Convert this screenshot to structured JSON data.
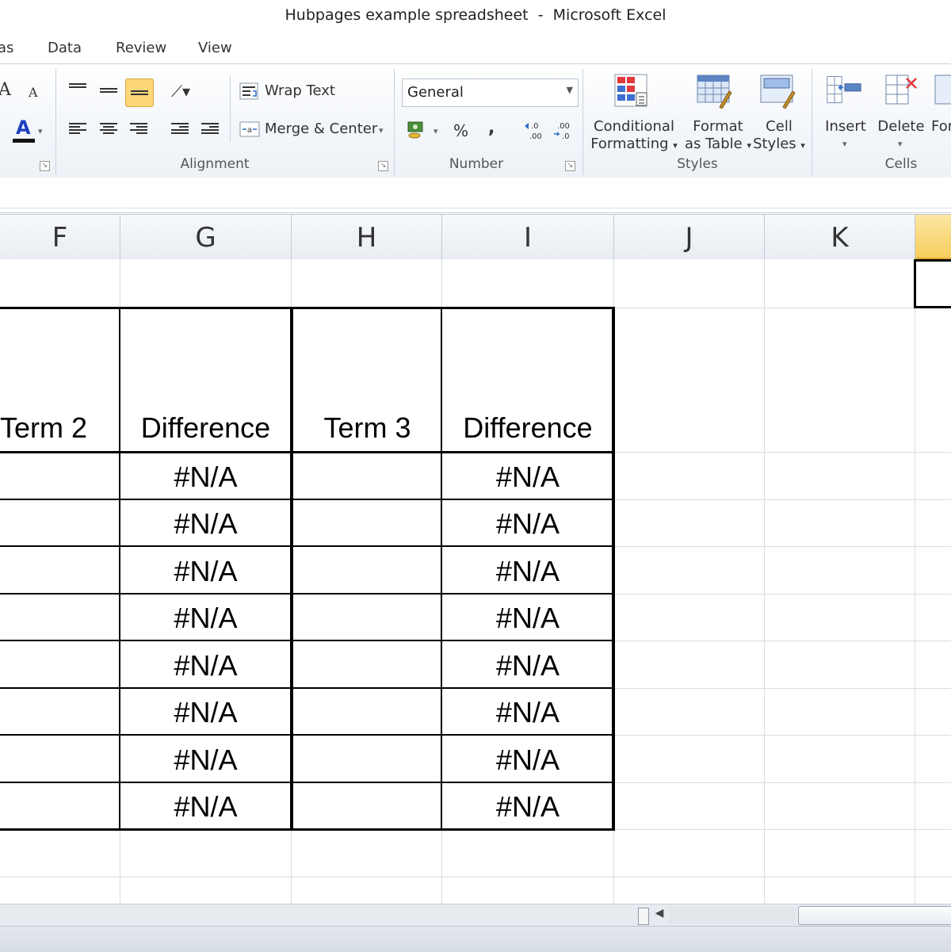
{
  "window": {
    "title": "Hubpages example spreadsheet  -  Microsoft Excel"
  },
  "ribbon_tabs": [
    "as",
    "Data",
    "Review",
    "View"
  ],
  "ribbon": {
    "font_group": {
      "grow_font": "A",
      "shrink_font": "A",
      "font_color": "A"
    },
    "alignment": {
      "wrap_text": "Wrap Text",
      "merge_center": "Merge & Center",
      "label": "Alignment"
    },
    "number": {
      "format": "General",
      "percent": "%",
      "comma": ",",
      "increase_decimal": ".0\n.00",
      "decrease_decimal": ".00\n.0",
      "label": "Number"
    },
    "styles": {
      "conditional_formatting": [
        "Conditional",
        "Formatting"
      ],
      "format_as_table": [
        "Format",
        "as Table"
      ],
      "cell_styles": [
        "Cell",
        "Styles"
      ],
      "label": "Styles"
    },
    "cells": {
      "insert": "Insert",
      "delete": "Delete",
      "format_partial": "For",
      "label": "Cells"
    }
  },
  "columns": [
    "F",
    "G",
    "H",
    "I",
    "J",
    "K"
  ],
  "table": {
    "headers": [
      "Term 2",
      "Difference",
      "Term 3",
      "Difference"
    ],
    "rows": [
      [
        "",
        "#N/A",
        "",
        "#N/A"
      ],
      [
        "",
        "#N/A",
        "",
        "#N/A"
      ],
      [
        "",
        "#N/A",
        "",
        "#N/A"
      ],
      [
        "",
        "#N/A",
        "",
        "#N/A"
      ],
      [
        "",
        "#N/A",
        "",
        "#N/A"
      ],
      [
        "",
        "#N/A",
        "",
        "#N/A"
      ],
      [
        "",
        "#N/A",
        "",
        "#N/A"
      ],
      [
        "",
        "#N/A",
        "",
        "#N/A"
      ]
    ]
  },
  "colors": {
    "accent_selected": "#f7ce5e",
    "ribbon_bg": "#eef2f7",
    "grid_line": "#d8dde3"
  },
  "icons": [
    "wrap-text-icon",
    "merge-center-icon",
    "conditional-formatting-icon",
    "format-table-icon",
    "cell-styles-icon",
    "insert-cells-icon",
    "delete-cells-icon"
  ]
}
